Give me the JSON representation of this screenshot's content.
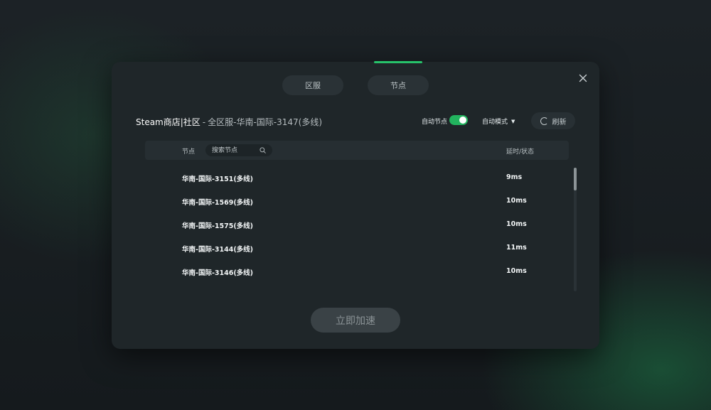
{
  "dialog": {
    "tabs": [
      {
        "label": "区服"
      },
      {
        "label": "节点"
      }
    ],
    "game_name": "Steam商店|社区",
    "separator": "-",
    "current_node": "全区服-华南-国际-3147(多线)",
    "auto_node_label": "自动节点",
    "auto_node_enabled": true,
    "mode_label": "自动模式",
    "refresh_label": "刷新",
    "table": {
      "node_header": "节点",
      "search_placeholder": "搜索节点",
      "latency_header": "延时/状态",
      "rows": [
        {
          "name": "华南-国际-3151(多线)",
          "latency": "9ms"
        },
        {
          "name": "华南-国际-1569(多线)",
          "latency": "10ms"
        },
        {
          "name": "华南-国际-1575(多线)",
          "latency": "10ms"
        },
        {
          "name": "华南-国际-3144(多线)",
          "latency": "11ms"
        },
        {
          "name": "华南-国际-3146(多线)",
          "latency": "10ms"
        }
      ]
    },
    "accelerate_label": "立即加速"
  },
  "colors": {
    "accent": "#27c26a",
    "toggle_on": "#22b35e",
    "dialog_bg": "#1f2629",
    "page_bg": "#161b1f"
  },
  "icons": [
    "close-icon",
    "search-icon",
    "refresh-icon",
    "chevron-down-icon"
  ]
}
